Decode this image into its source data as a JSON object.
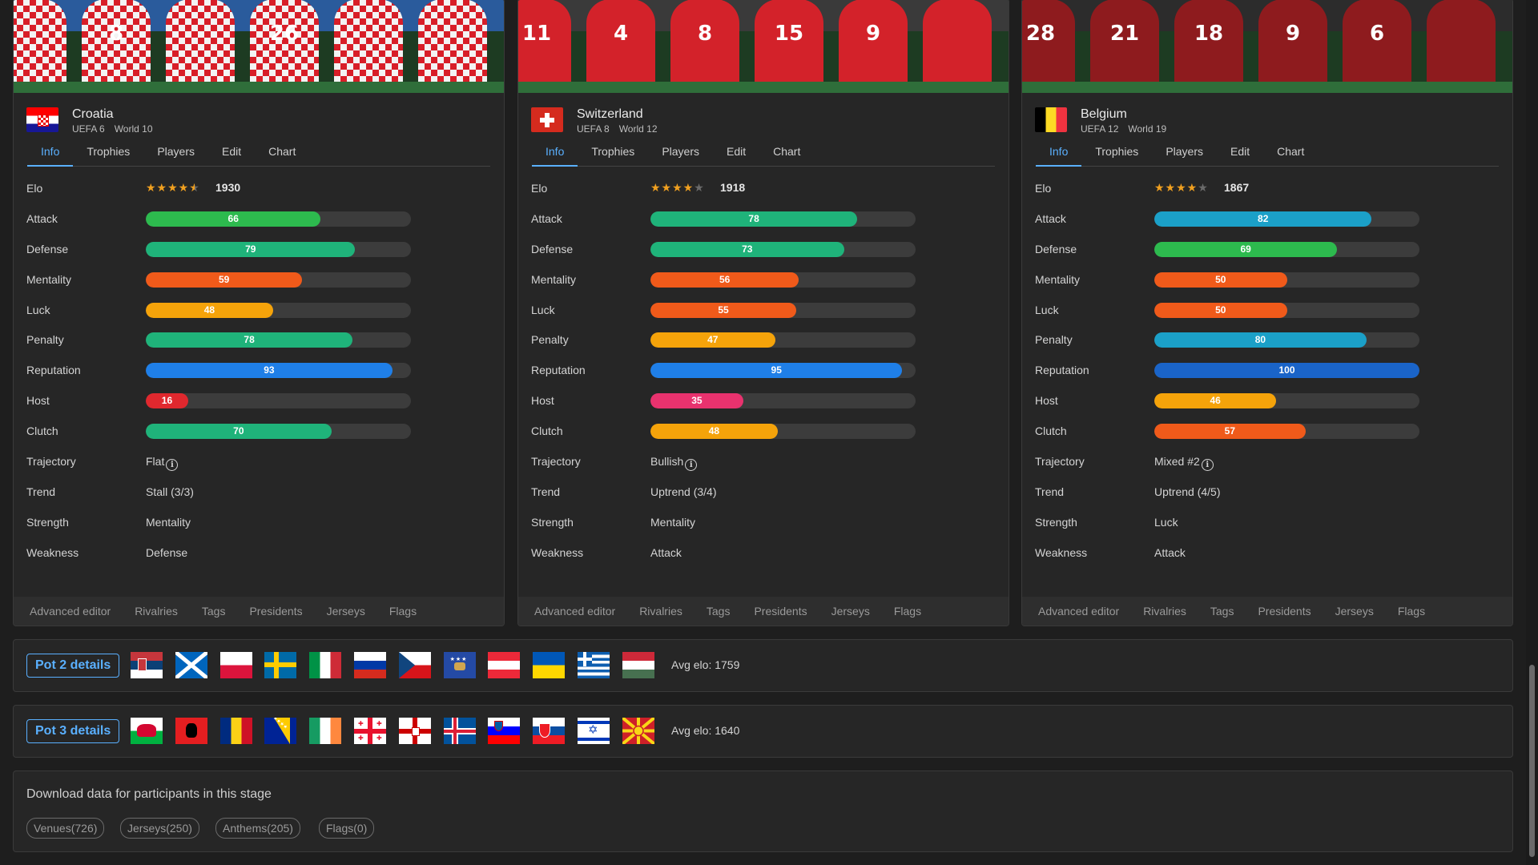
{
  "teams": [
    {
      "name": "Croatia",
      "uefa": "UEFA 6",
      "world": "World 10",
      "tabs": [
        "Info",
        "Trophies",
        "Players",
        "Edit",
        "Chart"
      ],
      "elo": "1930",
      "stars": 4.5,
      "stats": [
        {
          "label": "Attack",
          "value": 66,
          "color": "#2dba4e"
        },
        {
          "label": "Defense",
          "value": 79,
          "color": "#1fb37a"
        },
        {
          "label": "Mentality",
          "value": 59,
          "color": "#f05a1a"
        },
        {
          "label": "Luck",
          "value": 48,
          "color": "#f5a30a"
        },
        {
          "label": "Penalty",
          "value": 78,
          "color": "#1fb37a"
        },
        {
          "label": "Reputation",
          "value": 93,
          "color": "#1f7fe8"
        },
        {
          "label": "Host",
          "value": 16,
          "color": "#e0282e"
        },
        {
          "label": "Clutch",
          "value": 70,
          "color": "#1fb37a"
        }
      ],
      "trajectory": "Flat",
      "trend": "Stall (3/3)",
      "strength": "Mentality",
      "weakness": "Defense",
      "footer": [
        "Advanced editor",
        "Rivalries",
        "Tags",
        "Presidents",
        "Jerseys",
        "Flags"
      ]
    },
    {
      "name": "Switzerland",
      "uefa": "UEFA 8",
      "world": "World 12",
      "tabs": [
        "Info",
        "Trophies",
        "Players",
        "Edit",
        "Chart"
      ],
      "elo": "1918",
      "stars": 4,
      "stats": [
        {
          "label": "Attack",
          "value": 78,
          "color": "#1fb37a"
        },
        {
          "label": "Defense",
          "value": 73,
          "color": "#1fb37a"
        },
        {
          "label": "Mentality",
          "value": 56,
          "color": "#f05a1a"
        },
        {
          "label": "Luck",
          "value": 55,
          "color": "#f05a1a"
        },
        {
          "label": "Penalty",
          "value": 47,
          "color": "#f5a30a"
        },
        {
          "label": "Reputation",
          "value": 95,
          "color": "#1f7fe8"
        },
        {
          "label": "Host",
          "value": 35,
          "color": "#e8326e"
        },
        {
          "label": "Clutch",
          "value": 48,
          "color": "#f5a30a"
        }
      ],
      "trajectory": "Bullish",
      "trend": "Uptrend (3/4)",
      "strength": "Mentality",
      "weakness": "Attack",
      "footer": [
        "Advanced editor",
        "Rivalries",
        "Tags",
        "Presidents",
        "Jerseys",
        "Flags"
      ]
    },
    {
      "name": "Belgium",
      "uefa": "UEFA 12",
      "world": "World 19",
      "tabs": [
        "Info",
        "Trophies",
        "Players",
        "Edit",
        "Chart"
      ],
      "elo": "1867",
      "stars": 4,
      "stats": [
        {
          "label": "Attack",
          "value": 82,
          "color": "#1ba0c8"
        },
        {
          "label": "Defense",
          "value": 69,
          "color": "#2dba4e"
        },
        {
          "label": "Mentality",
          "value": 50,
          "color": "#f05a1a"
        },
        {
          "label": "Luck",
          "value": 50,
          "color": "#f05a1a"
        },
        {
          "label": "Penalty",
          "value": 80,
          "color": "#1ba0c8"
        },
        {
          "label": "Reputation",
          "value": 100,
          "color": "#1a64c8"
        },
        {
          "label": "Host",
          "value": 46,
          "color": "#f5a30a"
        },
        {
          "label": "Clutch",
          "value": 57,
          "color": "#f05a1a"
        }
      ],
      "trajectory": "Mixed #2",
      "trend": "Uptrend (4/5)",
      "strength": "Luck",
      "weakness": "Attack",
      "footer": [
        "Advanced editor",
        "Rivalries",
        "Tags",
        "Presidents",
        "Jerseys",
        "Flags"
      ]
    }
  ],
  "labels": {
    "elo": "Elo",
    "trajectory": "Trajectory",
    "trend": "Trend",
    "strength": "Strength",
    "weakness": "Weakness"
  },
  "pots": [
    {
      "button": "Pot 2 details",
      "avg": "Avg elo: 1759",
      "flags": [
        "serbia-flag",
        "scotland-flag",
        "poland-flag",
        "sweden-flag",
        "italy-flag",
        "russia-flag",
        "czechia-flag",
        "kosovo-flag",
        "austria-flag",
        "ukraine-flag",
        "greece-flag",
        "hungary-flag"
      ]
    },
    {
      "button": "Pot 3 details",
      "avg": "Avg elo: 1640",
      "flags": [
        "wales-flag",
        "albania-flag",
        "romania-flag",
        "bosnia-flag",
        "ireland-flag",
        "georgia-flag",
        "northern-ireland-flag",
        "iceland-flag",
        "slovenia-flag",
        "slovakia-flag",
        "israel-flag",
        "north-macedonia-flag"
      ]
    }
  ],
  "download": {
    "title": "Download data for participants in this stage",
    "chips": [
      "Venues(726)",
      "Jerseys(250)",
      "Anthems(205)",
      "Flags(0)"
    ]
  }
}
